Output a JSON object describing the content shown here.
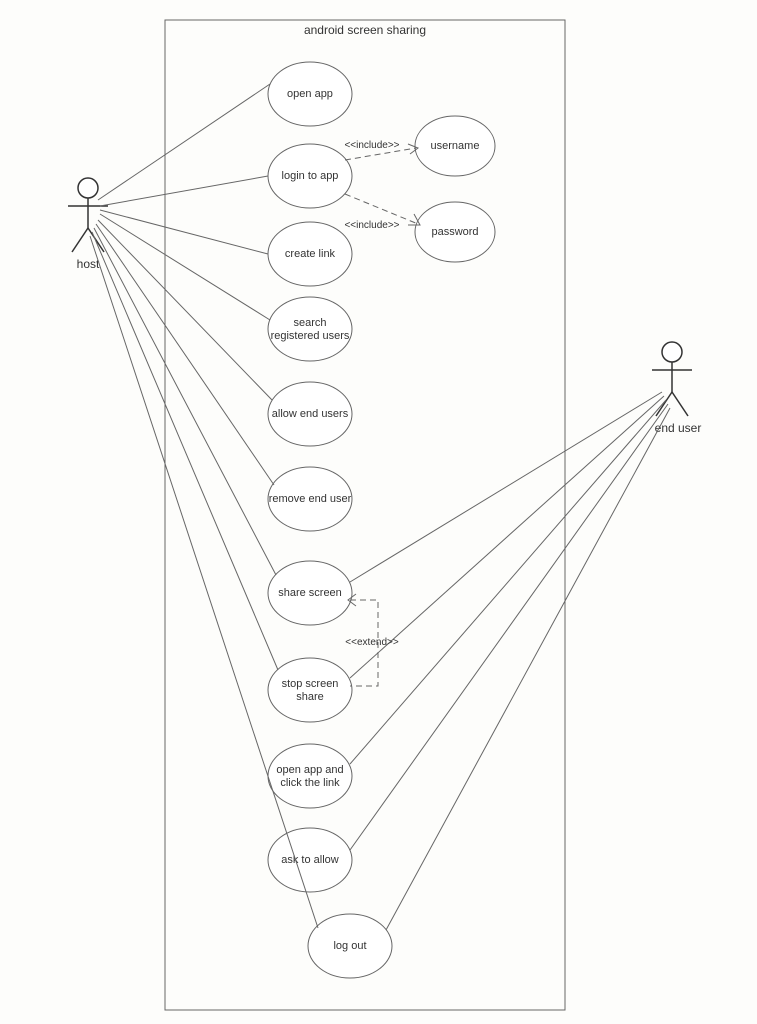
{
  "system": {
    "title": "android screen sharing"
  },
  "actors": {
    "host": {
      "label": "host"
    },
    "enduser": {
      "label": "end user"
    }
  },
  "usecases": {
    "open_app": "open app",
    "login": "login to app",
    "create_link": "create link",
    "search_users_l1": "search",
    "search_users_l2": "registered users",
    "allow_end_users": "allow end users",
    "remove_end_user": "remove end user",
    "share_screen": "share screen",
    "stop_share_l1": "stop screen",
    "stop_share_l2": "share",
    "open_click_l1": "open app and",
    "open_click_l2": "click the link",
    "ask_allow": "ask to allow",
    "logout": "log out",
    "username": "username",
    "password": "password"
  },
  "stereotypes": {
    "include": "<<include>>",
    "extend": "<<extend>>"
  },
  "chart_data": {
    "type": "uml-use-case",
    "title": "android screen sharing",
    "actors": [
      "host",
      "end user"
    ],
    "use_cases": [
      "open app",
      "login to app",
      "create link",
      "search registered users",
      "allow end users",
      "remove end user",
      "share screen",
      "stop screen share",
      "open app and click the link",
      "ask to allow",
      "log out",
      "username",
      "password"
    ],
    "associations": {
      "host": [
        "open app",
        "login to app",
        "create link",
        "search registered users",
        "allow end users",
        "remove end user",
        "share screen",
        "stop screen share",
        "log out"
      ],
      "end user": [
        "share screen",
        "stop screen share",
        "open app and click the link",
        "ask to allow",
        "log out"
      ]
    },
    "includes": [
      {
        "from": "login to app",
        "to": "username"
      },
      {
        "from": "login to app",
        "to": "password"
      }
    ],
    "extends": [
      {
        "from": "stop screen share",
        "to": "share screen"
      }
    ]
  }
}
